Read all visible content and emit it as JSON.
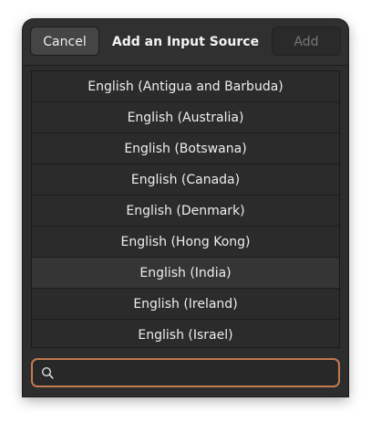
{
  "dialog": {
    "title": "Add an Input Source",
    "cancel_label": "Cancel",
    "add_label": "Add"
  },
  "list": {
    "items": [
      "English (Antigua and Barbuda)",
      "English (Australia)",
      "English (Botswana)",
      "English (Canada)",
      "English (Denmark)",
      "English (Hong Kong)",
      "English (India)",
      "English (Ireland)",
      "English (Israel)"
    ],
    "highlighted_index": 6
  },
  "search": {
    "value": "",
    "icon": "search-icon"
  },
  "colors": {
    "accent": "#c27a4e",
    "background": "#2d2d2d"
  }
}
